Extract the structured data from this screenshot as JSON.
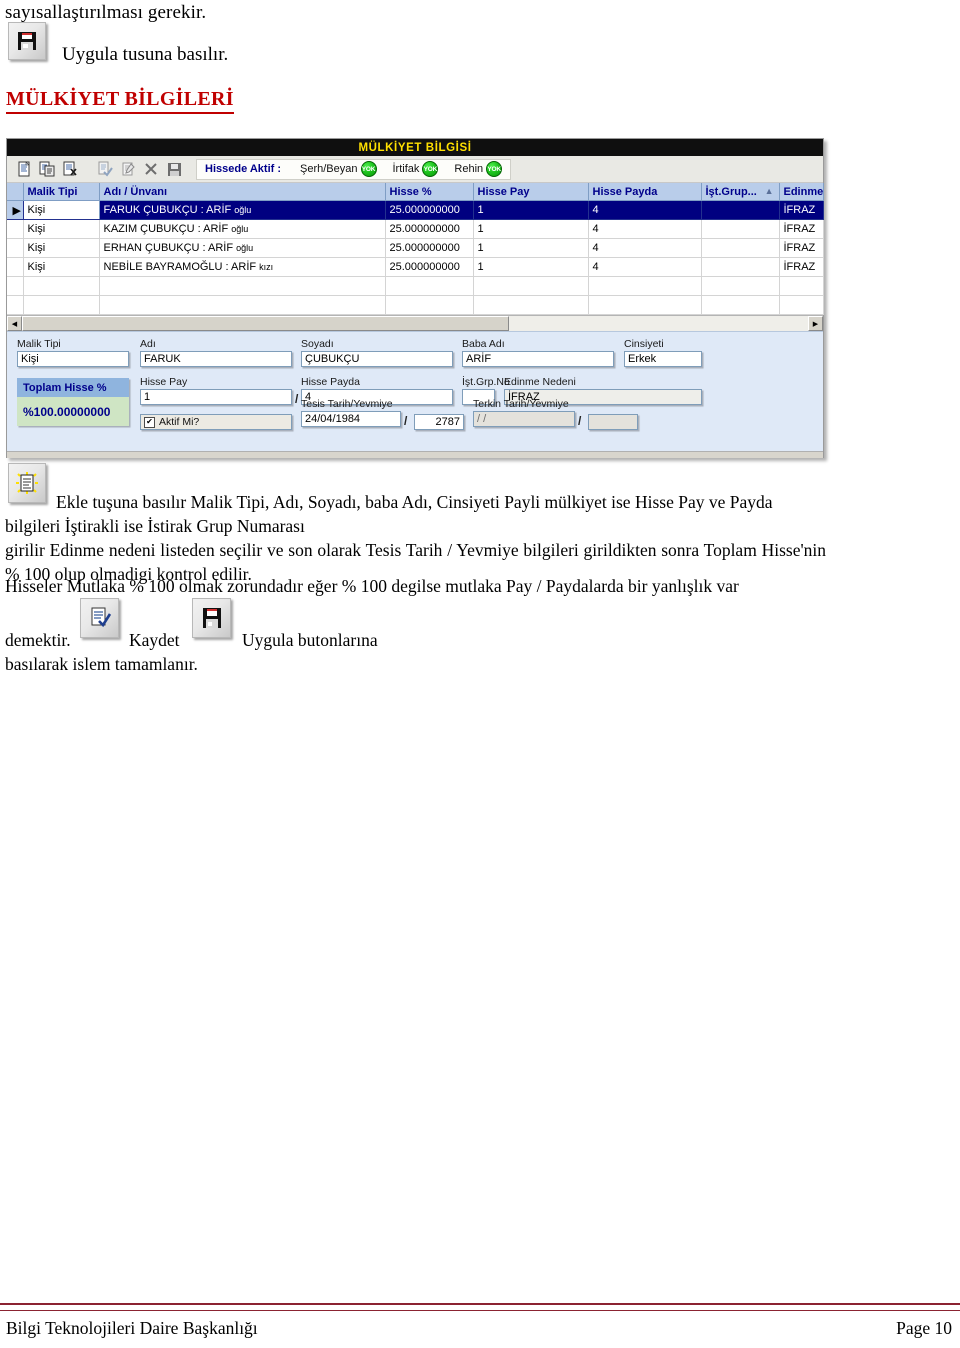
{
  "doc": {
    "intro_line": "sayısallaştırılması gerekir.",
    "uygula_text": "Uygula tusuna basılır.",
    "section_title": "MÜLKİYET BİLGİLERİ"
  },
  "window": {
    "title": "MÜLKİYET BİLGİSİ",
    "toolbar": {
      "buttons": [
        {
          "name": "new-record-icon",
          "glyph": "new"
        },
        {
          "name": "copy-record-icon",
          "glyph": "copy"
        },
        {
          "name": "delete-record-icon",
          "glyph": "delete"
        },
        {
          "name": "confirm-record-icon",
          "glyph": "check"
        },
        {
          "name": "edit-record-icon",
          "glyph": "edit"
        },
        {
          "name": "cancel-icon",
          "glyph": "x"
        },
        {
          "name": "save-icon",
          "glyph": "floppy"
        }
      ],
      "aktif_label": "Hissede Aktif :",
      "aktif_items": [
        {
          "label": "Şerh/Beyan",
          "badge": "YOK"
        },
        {
          "label": "İrtifak",
          "badge": "YOK"
        },
        {
          "label": "Rehin",
          "badge": "YOK"
        }
      ]
    },
    "grid": {
      "columns": [
        "Malik Tipi",
        "Adı / Ünvanı",
        "Hisse %",
        "Hisse Pay",
        "Hisse Payda",
        "İşt.Grup...",
        "Edinme"
      ],
      "sort_column_index": 5,
      "sort_arrow": "▲",
      "rows": [
        {
          "selected": true,
          "marker": "▶",
          "malik_tipi": "Kişi",
          "ad_unvan_main": "FARUK ÇUBUKÇU : ARİF ",
          "ad_unvan_suffix": "oğlu",
          "hisse_yuzde": "25.000000000",
          "hisse_pay": "1",
          "hisse_payda": "4",
          "ist_grup": "",
          "edinme": "İFRAZ"
        },
        {
          "selected": false,
          "marker": "",
          "malik_tipi": "Kişi",
          "ad_unvan_main": "KAZIM ÇUBUKÇU : ARİF ",
          "ad_unvan_suffix": "oğlu",
          "hisse_yuzde": "25.000000000",
          "hisse_pay": "1",
          "hisse_payda": "4",
          "ist_grup": "",
          "edinme": "İFRAZ"
        },
        {
          "selected": false,
          "marker": "",
          "malik_tipi": "Kişi",
          "ad_unvan_main": "ERHAN ÇUBUKÇU : ARİF ",
          "ad_unvan_suffix": "oğlu",
          "hisse_yuzde": "25.000000000",
          "hisse_pay": "1",
          "hisse_payda": "4",
          "ist_grup": "",
          "edinme": "İFRAZ"
        },
        {
          "selected": false,
          "marker": "",
          "malik_tipi": "Kişi",
          "ad_unvan_main": "NEBİLE BAYRAMOĞLU : ARİF ",
          "ad_unvan_suffix": "kızı",
          "hisse_yuzde": "25.000000000",
          "hisse_pay": "1",
          "hisse_payda": "4",
          "ist_grup": "",
          "edinme": "İFRAZ"
        }
      ]
    },
    "scrollbar": {
      "left_arrow": "◀",
      "right_arrow": "▶"
    },
    "form": {
      "malik_tipi": {
        "label": "Malik Tipi",
        "value": "Kişi"
      },
      "adi": {
        "label": "Adı",
        "value": "FARUK"
      },
      "soyadi": {
        "label": "Soyadı",
        "value": "ÇUBUKÇU"
      },
      "baba_adi": {
        "label": "Baba Adı",
        "value": "ARİF"
      },
      "cinsiyeti": {
        "label": "Cinsiyeti",
        "value": "Erkek"
      },
      "hisse_pay": {
        "label": "Hisse Pay",
        "value": "1"
      },
      "hisse_payda": {
        "label": "Hisse Payda",
        "value": "4"
      },
      "ist_grp_no": {
        "label": "İşt.Grp.No",
        "value": ""
      },
      "edinme_nedeni": {
        "label": "Edinme Nedeni",
        "value": "İFRAZ"
      },
      "tesis": {
        "label": "Tesis Tarih/Yevmiye",
        "date": "24/04/1984",
        "yevmiye": "2787"
      },
      "terkin": {
        "label": "Terkin Tarih/Yevmiye",
        "date": "/  /",
        "yevmiye": ""
      },
      "aktif": {
        "label": "Aktif Mi?",
        "checked": "✔"
      },
      "toplam": {
        "label": "Toplam Hisse %",
        "value": "%100.00000000"
      },
      "separator": "/"
    }
  },
  "body_text": {
    "p1": "Ekle tuşuna basılır Malik Tipi, Adı, Soyadı, baba Adı, Cinsiyeti Payli mülkiyet ise Hisse Pay ve Payda",
    "p1b": "bilgileri İştirakli ise İstirak Grup Numarası",
    "p2": "girilir Edinme nedeni listeden seçilir ve son olarak Tesis Tarih / Yevmiye bilgileri girildikten sonra Toplam Hisse'nin % 100 olup olmadigi kontrol edilir.",
    "p3": "Hisseler Mutlaka % 100 olmak zorundadır eğer % 100 degilse mutlaka Pay / Paydalarda bir yanlışlık var",
    "demektir": "demektir.",
    "kaydet": "Kaydet",
    "uygula": "Uygula butonlarına",
    "son": "basılarak islem tamamlanır."
  },
  "footer": {
    "left": "Bilgi Teknolojileri Daire Başkanlığı",
    "right": "Page 10"
  }
}
